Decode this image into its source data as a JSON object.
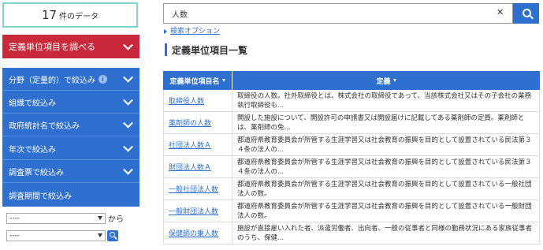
{
  "sidebar": {
    "count_number": "17",
    "count_label": "件のデータ",
    "browse_button": "定義単位項目を調べる",
    "filters": [
      "分野（定量的）で絞込み",
      "組織で絞込み",
      "政府統計名で絞込み",
      "年次で絞込み",
      "調査票で絞込み",
      "調査期間で絞込み"
    ],
    "period_from": "----",
    "period_to": "----",
    "period_kara": "から"
  },
  "search": {
    "value": "人数",
    "options_link": "検索オプション"
  },
  "main": {
    "title": "定義単位項目一覧",
    "columns": [
      "定義単位項目名",
      "定義"
    ],
    "rows": [
      {
        "name": "取締役人数",
        "def": "取締役の人数。社外取締役とは、株式会社の取締役であって、当該株式会社又はその子会社の業務執行取締役も..."
      },
      {
        "name": "薬剤師の人数",
        "def": "開設した施設について、開設許可の申請書又は開設届けに記載してある薬剤師の定員。薬剤師とは、薬剤師の免..."
      },
      {
        "name": "社団法人数Ａ",
        "def": "都道府県教育委員会が所管する生涯学習又は社会教育の振興を目的として設置されている民法第３４条の法人の..."
      },
      {
        "name": "財団法人数Ａ",
        "def": "都道府県教育委員会が所管する生涯学習又は社会教育の振興を目的として設置されている民法第３４条の法人の..."
      },
      {
        "name": "一般社団法人数",
        "def": "都道府県教育委員会が所管する生涯学習又は社会教育の振興を目的として設置されている一般社団法人の数。"
      },
      {
        "name": "一般財団法人数",
        "def": "都道府県教育委員会が所管する生涯学習又は社会教育の振興を目的として設置されている一般財団法人の数。"
      },
      {
        "name": "保健師の乗人数",
        "def": "施設が直接雇い入れた者、派遣労働者、出向者、一般の従事者と同様の勤務状況にある家族従事者のうち、保健..."
      }
    ]
  }
}
